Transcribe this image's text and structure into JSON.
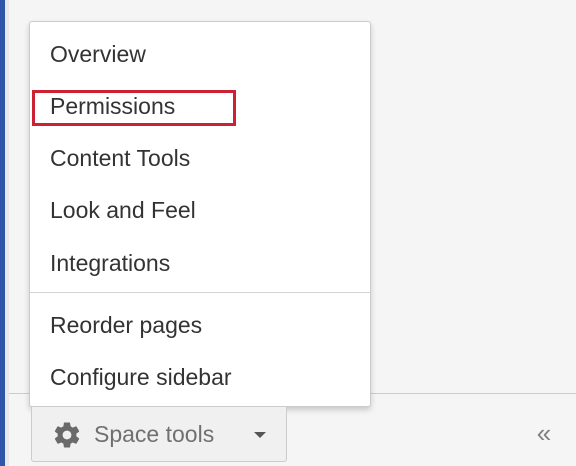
{
  "menu": {
    "items": [
      {
        "label": "Overview"
      },
      {
        "label": "Permissions"
      },
      {
        "label": "Content Tools"
      },
      {
        "label": "Look and Feel"
      },
      {
        "label": "Integrations"
      },
      {
        "label": "Reorder pages"
      },
      {
        "label": "Configure sidebar"
      }
    ]
  },
  "footer": {
    "space_tools_label": "Space tools",
    "collapse_glyph": "«"
  },
  "icons": {
    "settings": "gear-icon",
    "dropdown": "caret-down-icon",
    "collapse": "double-chevron-left-icon"
  },
  "colors": {
    "accent_border": "#2f54a8",
    "highlight": "#cc2233",
    "menu_bg": "#ffffff",
    "sidebar_bg": "#f5f5f5"
  }
}
